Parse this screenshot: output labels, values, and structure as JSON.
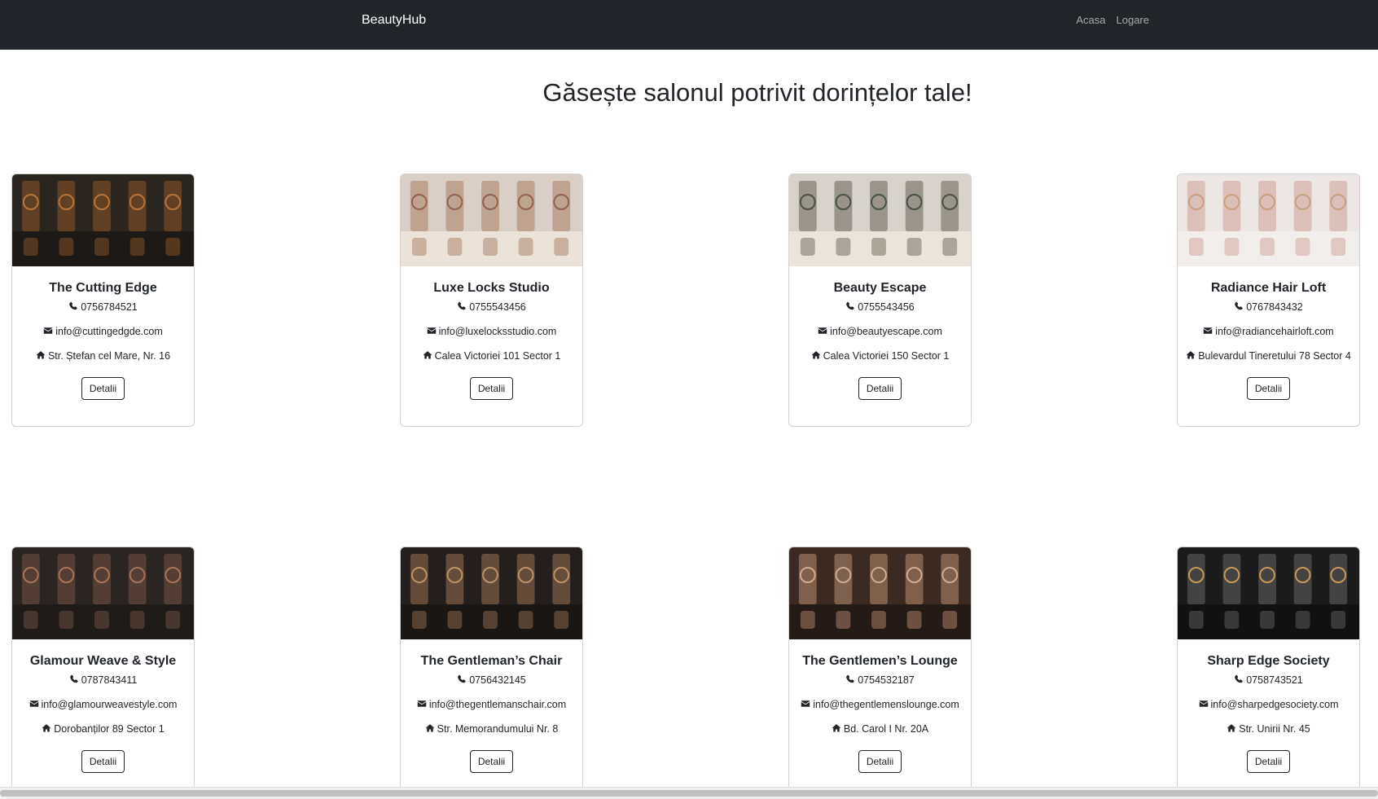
{
  "nav": {
    "brand": "BeautyHub",
    "links": [
      "Acasa",
      "Logare"
    ]
  },
  "headline": "Găsește salonul potrivit dorințelor tale!",
  "cards": [
    {
      "name": "The Cutting Edge",
      "phone": "0756784521",
      "email": "info@cuttingedgde.com",
      "address": "Str. Ștefan cel Mare, Nr. 16",
      "button": "Detalii"
    },
    {
      "name": "Luxe Locks Studio",
      "phone": "0755543456",
      "email": "info@luxelocksstudio.com",
      "address": "Calea Victoriei 101 Sector 1",
      "button": "Detalii"
    },
    {
      "name": "Beauty Escape",
      "phone": "0755543456",
      "email": "info@beautyescape.com",
      "address": "Calea Victoriei 150 Sector 1",
      "button": "Detalii"
    },
    {
      "name": "Radiance Hair Loft",
      "phone": "0767843432",
      "email": "info@radiancehairloft.com",
      "address": "Bulevardul Tineretului 78 Sector 4",
      "button": "Detalii"
    },
    {
      "name": "Glamour Weave & Style",
      "phone": "0787843411",
      "email": "info@glamourweavestyle.com",
      "address": "Dorobanților 89 Sector 1",
      "button": "Detalii"
    },
    {
      "name": "The Gentleman’s Chair",
      "phone": "0756432145",
      "email": "info@thegentlemanschair.com",
      "address": "Str. Memorandumului Nr. 8",
      "button": "Detalii"
    },
    {
      "name": "The Gentlemen’s Lounge",
      "phone": "0754532187",
      "email": "info@thegentlemenslounge.com",
      "address": "Bd. Carol I Nr. 20A",
      "button": "Detalii"
    },
    {
      "name": "Sharp Edge Society",
      "phone": "0758743521",
      "email": "info@sharpedgesociety.com",
      "address": "Str. Unirii Nr. 45",
      "button": "Detalii"
    }
  ],
  "icons": {
    "phone": "phone-icon",
    "email": "envelope-icon",
    "address": "home-icon"
  }
}
